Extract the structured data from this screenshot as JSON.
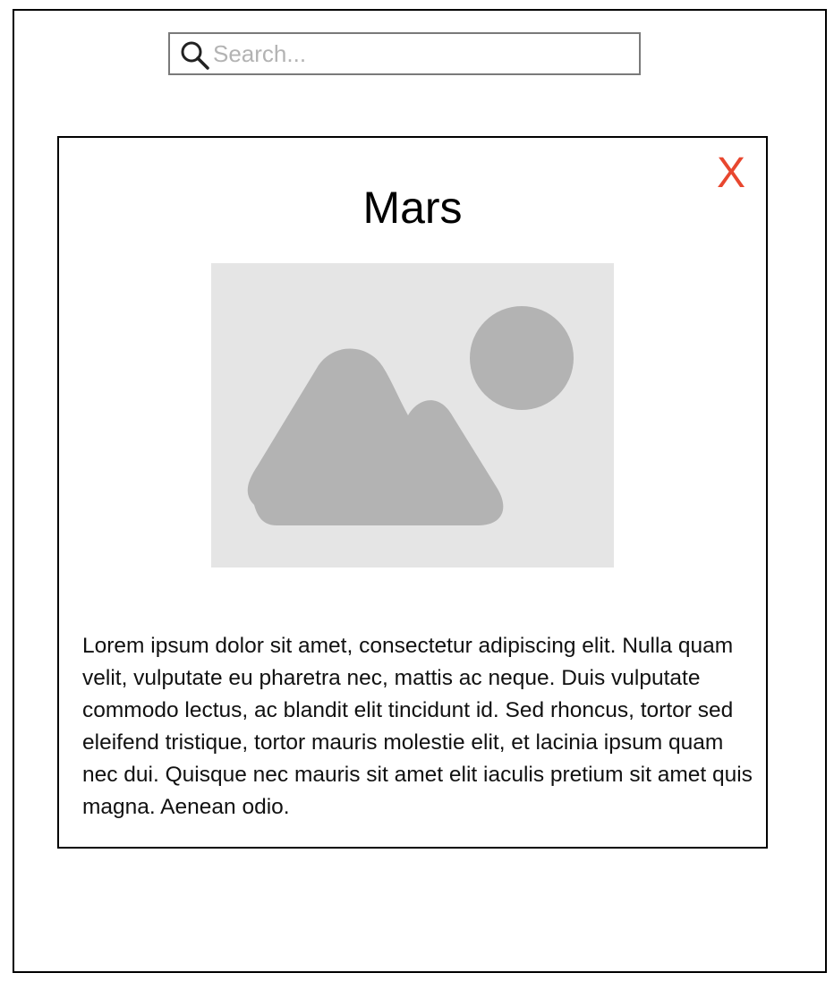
{
  "search": {
    "placeholder": "Search..."
  },
  "card": {
    "close_label": "X",
    "title": "Mars",
    "body": "Lorem ipsum dolor sit amet, consectetur adipiscing elit. Nulla quam velit, vulputate eu pharetra nec, mattis ac neque. Duis vulputate commodo lectus, ac blandit elit tincidunt id. Sed rhoncus, tortor sed eleifend tristique, tortor mauris molestie elit, et lacinia ipsum quam nec dui. Quisque nec mauris sit amet elit iaculis pretium sit amet quis magna. Aenean odio.",
    "image_icon": "image-placeholder-icon"
  },
  "icons": {
    "search": "search-icon",
    "close": "close-icon"
  },
  "colors": {
    "close": "#e8472f",
    "border": "#000000",
    "search_border": "#7a7a7a",
    "image_bg": "#e5e5e5",
    "image_fg": "#b3b3b3",
    "placeholder": "#b3b3b3",
    "text": "#111111"
  }
}
